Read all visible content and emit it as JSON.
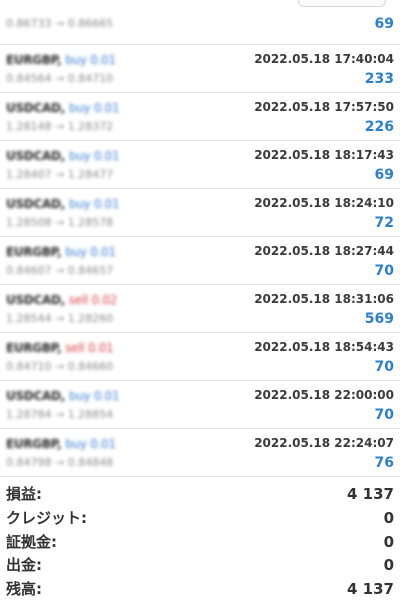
{
  "deals": [
    {
      "symbol": "",
      "side": "",
      "side_type": "",
      "prices": "0.86733 → 0.86665",
      "time": "",
      "profit": "69"
    },
    {
      "symbol": "EURGBP,",
      "side": "buy 0.01",
      "side_type": "buy",
      "prices": "0.84564 → 0.84710",
      "time": "2022.05.18 17:40:04",
      "profit": "233"
    },
    {
      "symbol": "USDCAD,",
      "side": "buy 0.01",
      "side_type": "buy",
      "prices": "1.28148 → 1.28372",
      "time": "2022.05.18 17:57:50",
      "profit": "226"
    },
    {
      "symbol": "USDCAD,",
      "side": "buy 0.01",
      "side_type": "buy",
      "prices": "1.28407 → 1.28477",
      "time": "2022.05.18 18:17:43",
      "profit": "69"
    },
    {
      "symbol": "USDCAD,",
      "side": "buy 0.01",
      "side_type": "buy",
      "prices": "1.28508 → 1.28578",
      "time": "2022.05.18 18:24:10",
      "profit": "72"
    },
    {
      "symbol": "EURGBP,",
      "side": "buy 0.01",
      "side_type": "buy",
      "prices": "0.84607 → 0.84657",
      "time": "2022.05.18 18:27:44",
      "profit": "70"
    },
    {
      "symbol": "USDCAD,",
      "side": "sell 0.02",
      "side_type": "sell",
      "prices": "1.28544 → 1.28260",
      "time": "2022.05.18 18:31:06",
      "profit": "569"
    },
    {
      "symbol": "EURGBP,",
      "side": "sell 0.01",
      "side_type": "sell",
      "prices": "0.84710 → 0.84660",
      "time": "2022.05.18 18:54:43",
      "profit": "70"
    },
    {
      "symbol": "USDCAD,",
      "side": "buy 0.01",
      "side_type": "buy",
      "prices": "1.28784 → 1.28854",
      "time": "2022.05.18 22:00:00",
      "profit": "70"
    },
    {
      "symbol": "EURGBP,",
      "side": "buy 0.01",
      "side_type": "buy",
      "prices": "0.84798 → 0.84848",
      "time": "2022.05.18 22:24:07",
      "profit": "76"
    }
  ],
  "summary": [
    {
      "label": "損益:",
      "value": "4 137"
    },
    {
      "label": "クレジット:",
      "value": "0"
    },
    {
      "label": "証拠金:",
      "value": "0"
    },
    {
      "label": "出金:",
      "value": "0"
    },
    {
      "label": "残高:",
      "value": "4 137"
    }
  ],
  "colors": {
    "buy": "#3d7fd6",
    "sell": "#d64545",
    "profit": "#2a7fd0"
  }
}
